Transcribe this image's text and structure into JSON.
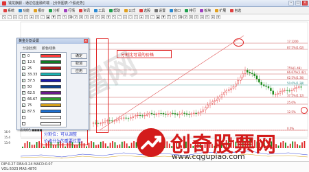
{
  "window": {
    "title": "钱龙旗舰 - 通达信金融终端 - [分析图表-个股走势]",
    "controls": [
      "–",
      "□",
      "×"
    ]
  },
  "menu": {
    "items": [
      "系统",
      "功能",
      "报价",
      "分析",
      "行情",
      "资讯",
      "工具",
      "帮助",
      "公式",
      "选股",
      "设置",
      "窗口",
      "排行",
      "板块",
      "扩展",
      "自选",
      "终端",
      "大盘",
      "个股",
      "期货"
    ]
  },
  "dialog": {
    "title": "黄金分割设置",
    "col_ratio": "分割比例",
    "col_color": "颜色线条",
    "rows": [
      {
        "value": "0",
        "color": "#ff3b3b",
        "checked": "✓"
      },
      {
        "value": "12.5",
        "color": "#0f7a24",
        "checked": "✓"
      },
      {
        "value": "25",
        "color": "#a81a1a",
        "checked": "✓"
      },
      {
        "value": "33.33",
        "color": "#1bb5b5",
        "checked": "✓"
      },
      {
        "value": "37.5",
        "color": "#1a1aa8",
        "checked": "✓"
      },
      {
        "value": "50",
        "color": "#0b3f8c",
        "checked": "✓"
      },
      {
        "value": "62.5",
        "color": "#6a1a8a",
        "checked": "✓"
      },
      {
        "value": "66.67",
        "color": "#2f9a2f",
        "checked": "✓"
      },
      {
        "value": "75",
        "color": "#d4a01a",
        "checked": "✓"
      },
      {
        "value": "87.5",
        "color": "#1a70d4",
        "checked": "✓"
      },
      {
        "value": "",
        "color": "#ffffff",
        "checked": ""
      },
      {
        "value": "",
        "color": "#ffffff",
        "checked": ""
      }
    ],
    "buttons": {
      "ok": "确定",
      "cancel": "取消",
      "apply": "应用"
    },
    "footer": "画线颜色 ■■■■"
  },
  "annotations": {
    "top_note": "分割比可设的价格",
    "bottom_note_1": "分割位：可以调整",
    "bottom_note_2": "价格分为的重要位置。"
  },
  "watermark": {
    "text": "中财富网"
  },
  "brand": {
    "name": "创奇股票网",
    "url": "www.cqgupiao.com"
  },
  "price_labels": [
    {
      "text": "17.2200",
      "color": "#c03030"
    },
    {
      "text": "87.5%(1.62)",
      "color": "#c03030"
    },
    {
      "text": "75%(1.48)",
      "color": "#c03030"
    },
    {
      "text": "66.67%(1.42)",
      "color": "#c03030"
    },
    {
      "text": "62.5%(1.36)",
      "color": "#c03030"
    },
    {
      "text": "50.0%(1.28)",
      "color": "#2b8a8a"
    },
    {
      "text": "37.5%(1.12)",
      "color": "#c03030"
    },
    {
      "text": "25.0%",
      "color": "#c03030"
    },
    {
      "text": "12.5%",
      "color": "#c03030"
    },
    {
      "text": "0.0%",
      "color": "#c03030"
    }
  ],
  "left_axis": {
    "values": [
      "16.9",
      "15.4",
      "13.9"
    ]
  },
  "status": {
    "line1": "DIF:0.27  DEA:0.24  MACD:0.07",
    "line2": "VOL:5023  MA5:4870"
  },
  "colors": {
    "up": "#e02424",
    "down": "#1a8a1a",
    "accent": "#d31b1b"
  }
}
